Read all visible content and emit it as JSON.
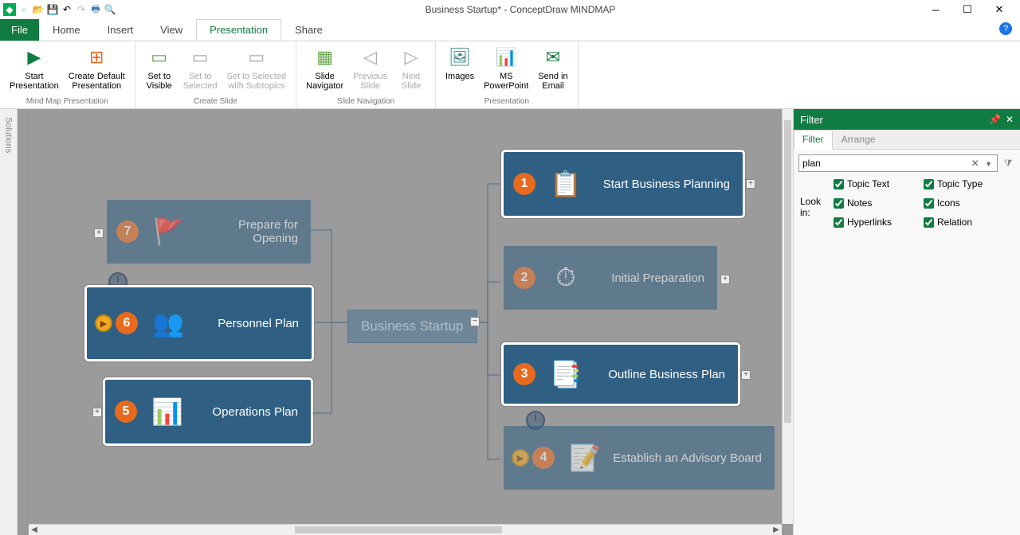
{
  "title": "Business Startup* - ConceptDraw MINDMAP",
  "menu": {
    "file": "File",
    "items": [
      "Home",
      "Insert",
      "View",
      "Presentation",
      "Share"
    ],
    "active": "Presentation"
  },
  "ribbon": {
    "groups": [
      {
        "label": "Mind Map Presentation",
        "buttons": [
          {
            "name": "start-presentation",
            "label": "Start\nPresentation",
            "icon": "▶",
            "color": "#107c41"
          },
          {
            "name": "create-default-presentation",
            "label": "Create Default\nPresentation",
            "icon": "⊞",
            "color": "#e76a1e"
          }
        ]
      },
      {
        "label": "Create Slide",
        "buttons": [
          {
            "name": "set-to-visible",
            "label": "Set to\nVisible",
            "icon": "▭",
            "color": "#6aa84f"
          },
          {
            "name": "set-to-selected",
            "label": "Set to\nSelected",
            "icon": "▭",
            "disabled": true
          },
          {
            "name": "set-to-selected-subtopics",
            "label": "Set to Selected\nwith Subtopics",
            "icon": "▭",
            "disabled": true
          }
        ]
      },
      {
        "label": "Slide Navigation",
        "buttons": [
          {
            "name": "slide-navigator",
            "label": "Slide\nNavigator",
            "icon": "▦",
            "color": "#6aa84f"
          },
          {
            "name": "previous-slide",
            "label": "Previous\nSlide",
            "icon": "◁",
            "disabled": true
          },
          {
            "name": "next-slide",
            "label": "Next\nSlide",
            "icon": "▷",
            "disabled": true
          }
        ]
      },
      {
        "label": "Presentation",
        "buttons": [
          {
            "name": "images",
            "label": "Images",
            "icon": "🖼",
            "color": "#3b8686"
          },
          {
            "name": "ms-powerpoint",
            "label": "MS\nPowerPoint",
            "icon": "📊",
            "color": "#d24726"
          },
          {
            "name": "send-in-email",
            "label": "Send in\nEmail",
            "icon": "✉",
            "color": "#107c41"
          }
        ]
      }
    ]
  },
  "solutions_tab": "Solutions",
  "mindmap": {
    "center": "Business Startup",
    "nodes": {
      "n1": {
        "num": "1",
        "label": "Start Business Planning",
        "icon": "📋",
        "hl": true
      },
      "n2": {
        "num": "2",
        "label": "Initial Preparation",
        "icon": "⏱",
        "dim": true
      },
      "n3": {
        "num": "3",
        "label": "Outline Business Plan",
        "icon": "📑",
        "hl": true
      },
      "n4": {
        "num": "4",
        "label": "Establish an Advisory Board",
        "icon": "📝",
        "dim": true,
        "play": true
      },
      "n6": {
        "num": "6",
        "label": "Personnel Plan",
        "icon": "👥",
        "hl": true,
        "play": true
      },
      "n7": {
        "num": "7",
        "label": "Prepare for Opening",
        "icon": "🚩",
        "dim": true
      },
      "n5": {
        "num": "5",
        "label": "Operations Plan",
        "icon": "📊",
        "hl": true
      }
    }
  },
  "filter": {
    "header": "Filter",
    "tabs": {
      "filter": "Filter",
      "arrange": "Arrange"
    },
    "search": "plan",
    "lookin_label": "Look in:",
    "checks": {
      "topic_text": "Topic Text",
      "topic_type": "Topic Type",
      "notes": "Notes",
      "icons": "Icons",
      "hyperlinks": "Hyperlinks",
      "relation": "Relation"
    }
  }
}
